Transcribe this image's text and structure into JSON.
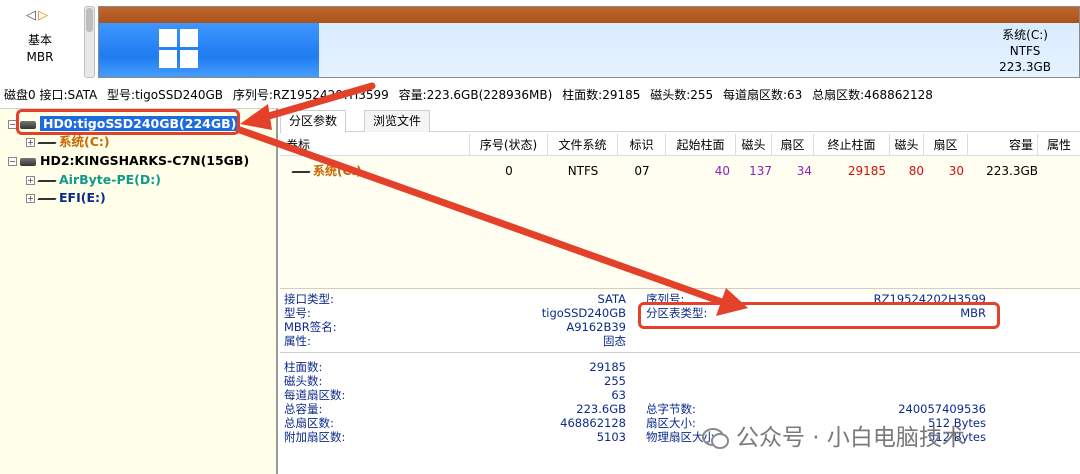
{
  "top": {
    "disk_type": "基本",
    "partition_style": "MBR",
    "partition_name": "系统(C:)",
    "filesystem": "NTFS",
    "size": "223.3GB"
  },
  "infoline": [
    "磁盘0 接口:SATA",
    "型号:tigoSSD240GB",
    "序列号:RZ1952420?H3599",
    "容量:223.6GB(228936MB)",
    "柱面数:29185",
    "磁头数:255",
    "每道扇区数:63",
    "总扇区数:468862128"
  ],
  "tree": {
    "hd0": "HD0:tigoSSD240GB(224GB)",
    "hd0_child": "系统(C:)",
    "hd2": "HD2:KINGSHARKS-C7N(15GB)",
    "hd2_child1": "AirByte-PE(D:)",
    "hd2_child2": "EFI(E:)"
  },
  "tabs": [
    "分区参数",
    "浏览文件"
  ],
  "table": {
    "headers": [
      "卷标",
      "序号(状态)",
      "文件系统",
      "标识",
      "起始柱面",
      "磁头",
      "扇区",
      "终止柱面",
      "磁头",
      "扇区",
      "容量",
      "属性"
    ],
    "row": {
      "label": "系统(C:)",
      "index": "0",
      "fs": "NTFS",
      "id": "07",
      "start_cyl": "40",
      "start_head": "137",
      "start_sec": "34",
      "end_cyl": "29185",
      "end_head": "80",
      "end_sec": "30",
      "capacity": "223.3GB",
      "attr": ""
    }
  },
  "detail1": {
    "iface_label": "接口类型:",
    "iface_value": "SATA",
    "model_label": "型号:",
    "model_value": "tigoSSD240GB",
    "mbrsig_label": "MBR签名:",
    "mbrsig_value": "A9162B39",
    "attr_label": "属性:",
    "attr_value": "固态",
    "serial_label": "序列号:",
    "serial_value": "RZ19524202H3599",
    "pttype_label": "分区表类型:",
    "pttype_value": "MBR"
  },
  "detail2": {
    "cyl_label": "柱面数:",
    "cyl_value": "29185",
    "head_label": "磁头数:",
    "head_value": "255",
    "spt_label": "每道扇区数:",
    "spt_value": "63",
    "cap_label": "总容量:",
    "cap_value": "223.6GB",
    "totsec_label": "总扇区数:",
    "totsec_value": "468862128",
    "extra_label": "附加扇区数:",
    "extra_value": "5103",
    "bytes_label": "总字节数:",
    "bytes_value": "240057409536",
    "secsize_label": "扇区大小:",
    "secsize_value": "512 Bytes",
    "physsec_label": "物理扇区大小:",
    "physsec_value": "512 Bytes"
  },
  "watermark": "公众号 · 小白电脑技术",
  "colors": {
    "accent_red": "#e4412a",
    "selection": "#1e6be0",
    "value_blue": "#0b2a8c"
  }
}
